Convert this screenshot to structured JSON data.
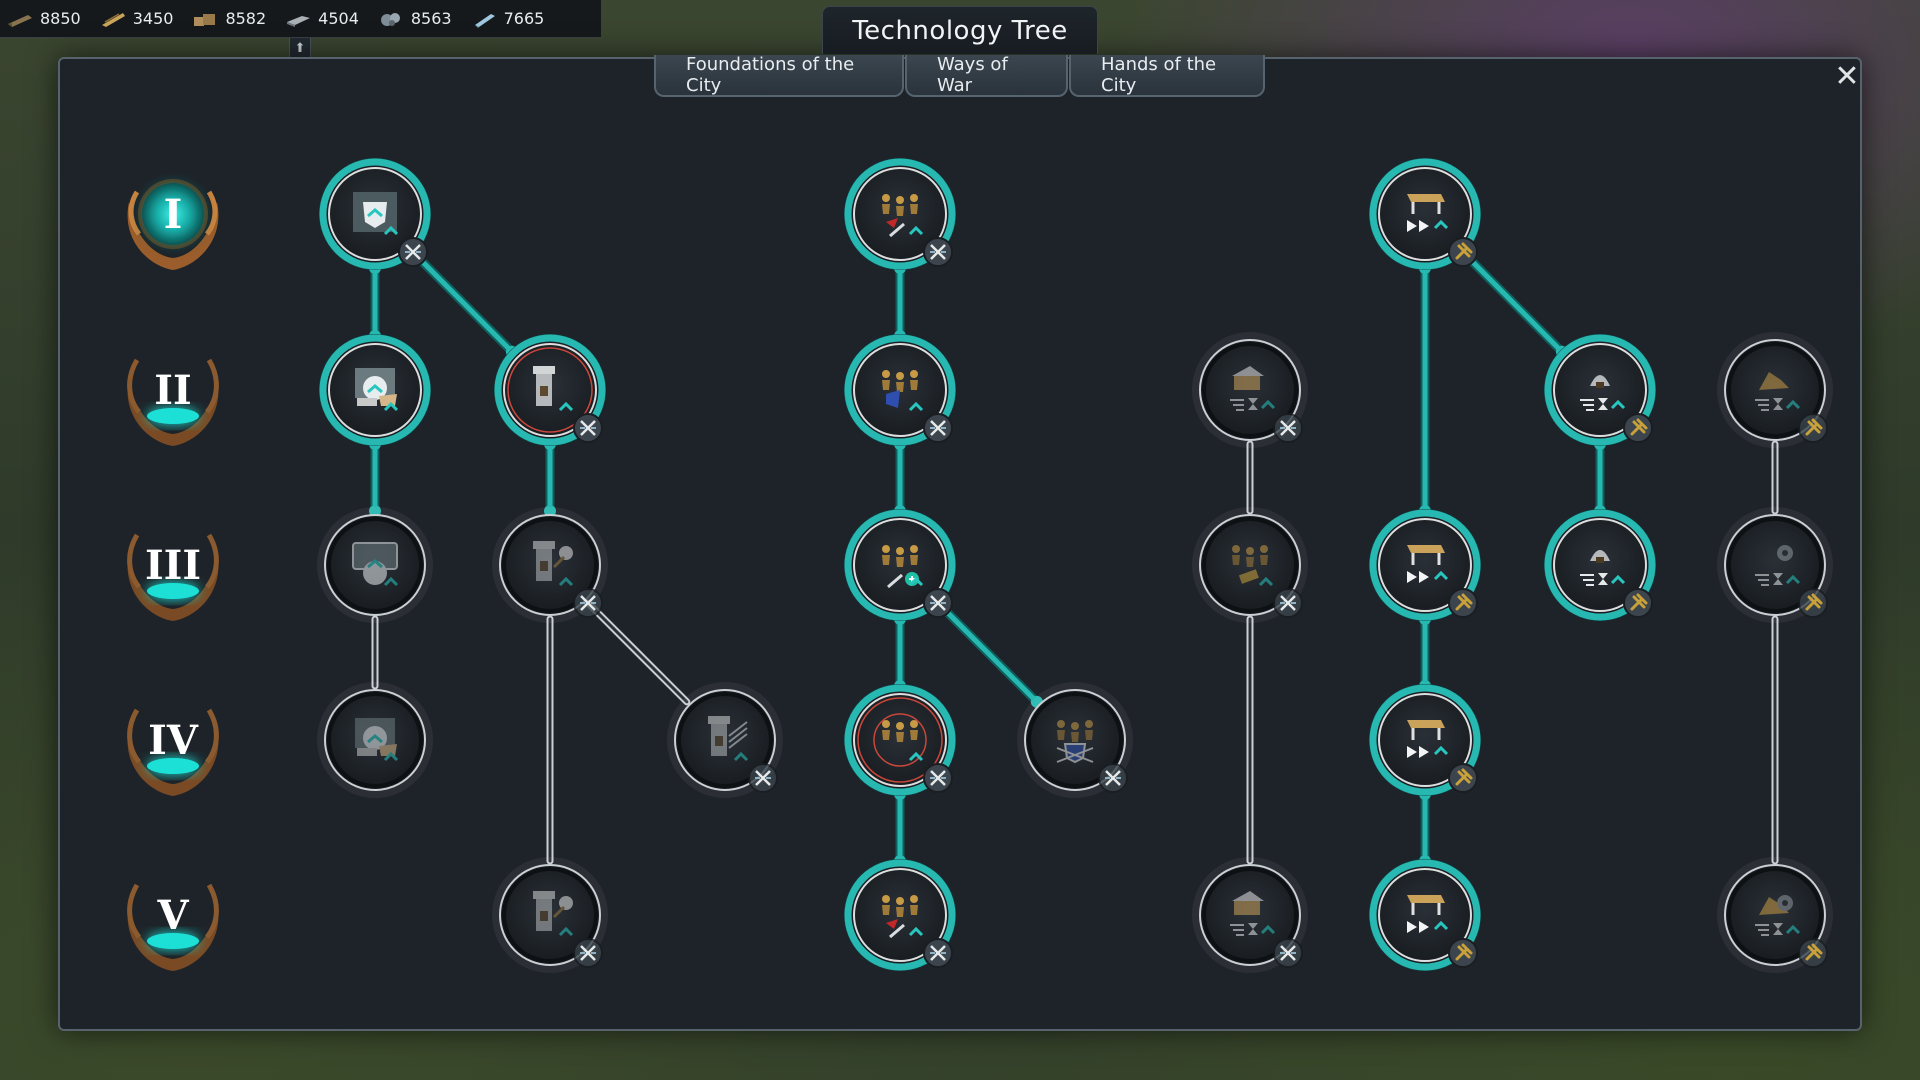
{
  "window": {
    "title": "Technology Tree"
  },
  "resources": [
    {
      "icon": "wood-plank-icon",
      "value": "8850"
    },
    {
      "icon": "lumber-icon",
      "value": "3450"
    },
    {
      "icon": "stone-block-icon",
      "value": "8582"
    },
    {
      "icon": "iron-ingot-icon",
      "value": "4504"
    },
    {
      "icon": "ore-icon",
      "value": "8563"
    },
    {
      "icon": "steel-bar-icon",
      "value": "7665"
    }
  ],
  "tabs": [
    {
      "label": "Foundations of the City"
    },
    {
      "label": "Ways of War"
    },
    {
      "label": "Hands of the City"
    }
  ],
  "tiers": [
    "I",
    "II",
    "III",
    "IV",
    "V"
  ],
  "colors": {
    "unlocked": "#27b8b2",
    "locked": "#3a4047",
    "node_fill": "#1b2025",
    "tier_bronze": "#a8672f",
    "badge_gold": "#c9a13a",
    "badge_steel": "#4e5862",
    "red_ring": "#c9473b"
  },
  "nodes": [
    {
      "id": "c1-t1",
      "icon": "shield-upgrade-icon",
      "state": "unlocked",
      "badge": "swords-badge-icon"
    },
    {
      "id": "c1-t2",
      "icon": "wall-building-icon",
      "state": "unlocked",
      "badge": "none"
    },
    {
      "id": "c1-t3",
      "icon": "blueprint-upgrade-icon",
      "state": "locked",
      "badge": "none"
    },
    {
      "id": "c1-t4",
      "icon": "wall-building-icon",
      "state": "locked",
      "badge": "none"
    },
    {
      "id": "c2-t2",
      "icon": "watchtower-icon",
      "state": "unlocked",
      "badge": "swords-badge-icon",
      "ring": "red"
    },
    {
      "id": "c2-t3",
      "icon": "watchtower-flail-icon",
      "state": "locked",
      "badge": "swords-badge-icon"
    },
    {
      "id": "c2-t5",
      "icon": "watchtower-flail-icon",
      "state": "locked",
      "badge": "swords-badge-icon"
    },
    {
      "id": "c3-t4",
      "icon": "watchtower-arrows-icon",
      "state": "locked",
      "badge": "swords-badge-icon"
    },
    {
      "id": "c4-t1",
      "icon": "soldiers-attack-icon",
      "state": "unlocked",
      "badge": "swords-badge-icon"
    },
    {
      "id": "c4-t2",
      "icon": "soldiers-defense-icon",
      "state": "unlocked",
      "badge": "swords-badge-icon"
    },
    {
      "id": "c4-t3",
      "icon": "soldiers-heal-icon",
      "state": "unlocked",
      "badge": "swords-badge-icon"
    },
    {
      "id": "c4-t4",
      "icon": "soldiers-formation-icon",
      "state": "unlocked",
      "badge": "swords-badge-icon",
      "ring": "red"
    },
    {
      "id": "c4-t5",
      "icon": "soldiers-attack-icon",
      "state": "unlocked",
      "badge": "swords-badge-icon"
    },
    {
      "id": "c5-t4",
      "icon": "soldiers-shield-icon",
      "state": "locked",
      "badge": "swords-badge-icon"
    },
    {
      "id": "c6-t2",
      "icon": "workshop-speed-icon",
      "state": "locked",
      "badge": "swords-badge-icon"
    },
    {
      "id": "c6-t3",
      "icon": "soldiers-resource-icon",
      "state": "locked",
      "badge": "swords-badge-icon"
    },
    {
      "id": "c6-t5",
      "icon": "workshop-speed-icon",
      "state": "locked",
      "badge": "swords-badge-icon"
    },
    {
      "id": "c7-t1",
      "icon": "table-speed-icon",
      "state": "unlocked",
      "badge": "gold-hammer-badge-icon"
    },
    {
      "id": "c7-t3",
      "icon": "table-speed-icon",
      "state": "unlocked",
      "badge": "gold-hammer-badge-icon"
    },
    {
      "id": "c7-t4",
      "icon": "table-speed-icon",
      "state": "unlocked",
      "badge": "gold-hammer-badge-icon"
    },
    {
      "id": "c7-t5",
      "icon": "table-speed-icon",
      "state": "unlocked",
      "badge": "gold-hammer-badge-icon"
    },
    {
      "id": "c8-t2",
      "icon": "kiln-time-icon",
      "state": "unlocked",
      "badge": "gold-hammer-badge-icon"
    },
    {
      "id": "c8-t3",
      "icon": "kiln-time-icon",
      "state": "unlocked",
      "badge": "gold-hammer-badge-icon"
    },
    {
      "id": "c9-t2",
      "icon": "gold-pile-time-icon",
      "state": "locked",
      "badge": "gold-hammer-badge-icon"
    },
    {
      "id": "c9-t3",
      "icon": "gear-time-icon",
      "state": "locked",
      "badge": "gold-hammer-badge-icon"
    },
    {
      "id": "c9-t5",
      "icon": "gold-gear-time-icon",
      "state": "locked",
      "badge": "gold-hammer-badge-icon"
    }
  ],
  "links": [
    [
      "c1-t1",
      "c1-t2",
      "unlocked"
    ],
    [
      "c1-t1",
      "c2-t2",
      "unlocked"
    ],
    [
      "c1-t2",
      "c1-t3",
      "unlocked"
    ],
    [
      "c1-t3",
      "c1-t4",
      "locked"
    ],
    [
      "c2-t2",
      "c2-t3",
      "unlocked"
    ],
    [
      "c2-t3",
      "c2-t5",
      "locked"
    ],
    [
      "c2-t3",
      "c3-t4",
      "locked"
    ],
    [
      "c4-t1",
      "c4-t2",
      "unlocked"
    ],
    [
      "c4-t2",
      "c4-t3",
      "unlocked"
    ],
    [
      "c4-t3",
      "c4-t4",
      "unlocked"
    ],
    [
      "c4-t3",
      "c5-t4",
      "unlocked"
    ],
    [
      "c4-t4",
      "c4-t5",
      "unlocked"
    ],
    [
      "c6-t2",
      "c6-t3",
      "locked"
    ],
    [
      "c6-t3",
      "c6-t5",
      "locked"
    ],
    [
      "c7-t1",
      "c7-t3",
      "unlocked"
    ],
    [
      "c7-t1",
      "c8-t2",
      "unlocked"
    ],
    [
      "c7-t3",
      "c7-t4",
      "unlocked"
    ],
    [
      "c7-t4",
      "c7-t5",
      "unlocked"
    ],
    [
      "c8-t2",
      "c8-t3",
      "unlocked"
    ],
    [
      "c9-t2",
      "c9-t3",
      "locked"
    ],
    [
      "c9-t3",
      "c9-t5",
      "locked"
    ]
  ]
}
